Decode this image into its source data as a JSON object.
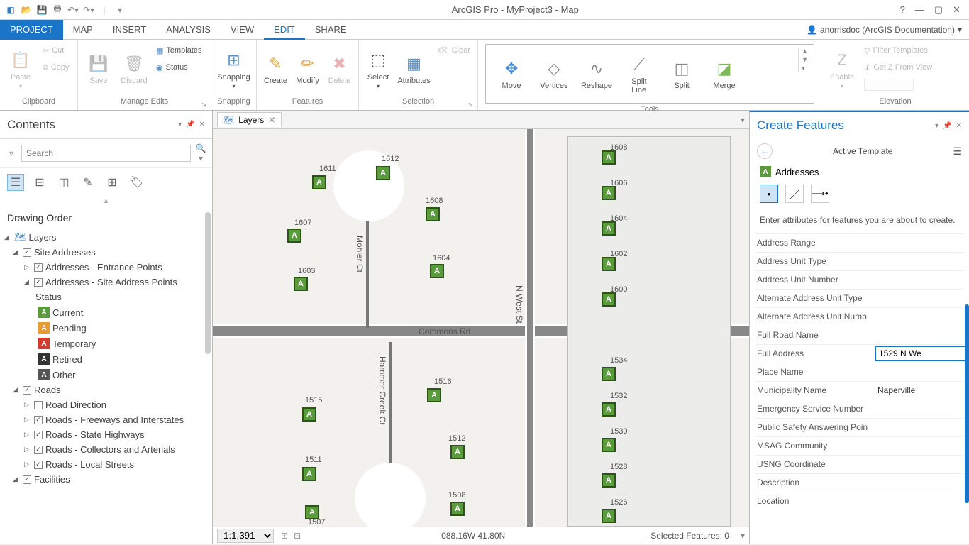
{
  "app": {
    "title": "ArcGIS Pro - MyProject3 - Map"
  },
  "user": {
    "label": "anorrisdoc (ArcGIS Documentation)"
  },
  "tabs": {
    "project": "PROJECT",
    "map": "MAP",
    "insert": "INSERT",
    "analysis": "ANALYSIS",
    "view": "VIEW",
    "edit": "EDIT",
    "share": "SHARE"
  },
  "ribbon": {
    "clipboard": {
      "label": "Clipboard",
      "paste": "Paste",
      "cut": "Cut",
      "copy": "Copy"
    },
    "manage": {
      "label": "Manage Edits",
      "save": "Save",
      "discard": "Discard",
      "templates": "Templates",
      "status": "Status"
    },
    "snapping": {
      "label": "Snapping",
      "snapping": "Snapping"
    },
    "features": {
      "label": "Features",
      "create": "Create",
      "modify": "Modify",
      "delete": "Delete"
    },
    "selection": {
      "label": "Selection",
      "select": "Select",
      "attributes": "Attributes",
      "clear": "Clear"
    },
    "tools": {
      "label": "Tools",
      "move": "Move",
      "vertices": "Vertices",
      "reshape": "Reshape",
      "splitline": "Split\nLine",
      "split": "Split",
      "merge": "Merge"
    },
    "elevation": {
      "label": "Elevation",
      "enable": "Enable",
      "filter": "Filter Templates",
      "getz": "Get Z From View"
    }
  },
  "contents": {
    "title": "Contents",
    "search_placeholder": "Search",
    "drawing_order": "Drawing Order",
    "layers": "Layers",
    "site_addresses": "Site Addresses",
    "entrance": "Addresses - Entrance Points",
    "site_points": "Addresses - Site Address Points",
    "status": "Status",
    "current": "Current",
    "pending": "Pending",
    "temporary": "Temporary",
    "retired": "Retired",
    "other": "Other",
    "roads": "Roads",
    "road_dir": "Road Direction",
    "freeways": "Roads - Freeways and Interstates",
    "state": "Roads - State Highways",
    "collectors": "Roads - Collectors and Arterials",
    "local": "Roads - Local Streets",
    "facilities": "Facilities"
  },
  "map": {
    "tab": "Layers",
    "scale": "1:1,391",
    "coords": "088.16W 41.80N",
    "selected": "Selected Features: 0",
    "roads": {
      "commons": "Commons Rd",
      "mohler": "Mohler Ct",
      "hammer": "Hammer Creek Ct",
      "nwest": "N West St"
    },
    "addrs": [
      "1608",
      "1606",
      "1604",
      "1602",
      "1600",
      "1534",
      "1532",
      "1530",
      "1528",
      "1526",
      "1608",
      "1611",
      "1612",
      "1607",
      "1604",
      "1603",
      "1515",
      "1511",
      "1507",
      "1516",
      "1512",
      "1508"
    ]
  },
  "cf": {
    "title": "Create Features",
    "active_template": "Active Template",
    "layer": "Addresses",
    "hint": "Enter attributes for features you are about to create.",
    "attrs": [
      {
        "label": "Address Range",
        "value": ""
      },
      {
        "label": "Address Unit Type",
        "value": ""
      },
      {
        "label": "Address Unit Number",
        "value": ""
      },
      {
        "label": "Alternate Address Unit Type",
        "value": ""
      },
      {
        "label": "Alternate Address Unit Numb",
        "value": ""
      },
      {
        "label": "Full Road Name",
        "value": ""
      },
      {
        "label": "Full Address",
        "value": "1529 N We",
        "editing": true
      },
      {
        "label": "Place Name",
        "value": ""
      },
      {
        "label": "Municipality Name",
        "value": "Naperville"
      },
      {
        "label": "Emergency Service Number",
        "value": ""
      },
      {
        "label": "Public Safety Answering Poin",
        "value": ""
      },
      {
        "label": "MSAG Community",
        "value": ""
      },
      {
        "label": "USNG Coordinate",
        "value": ""
      },
      {
        "label": "Description",
        "value": ""
      },
      {
        "label": "Location",
        "value": ""
      }
    ]
  }
}
